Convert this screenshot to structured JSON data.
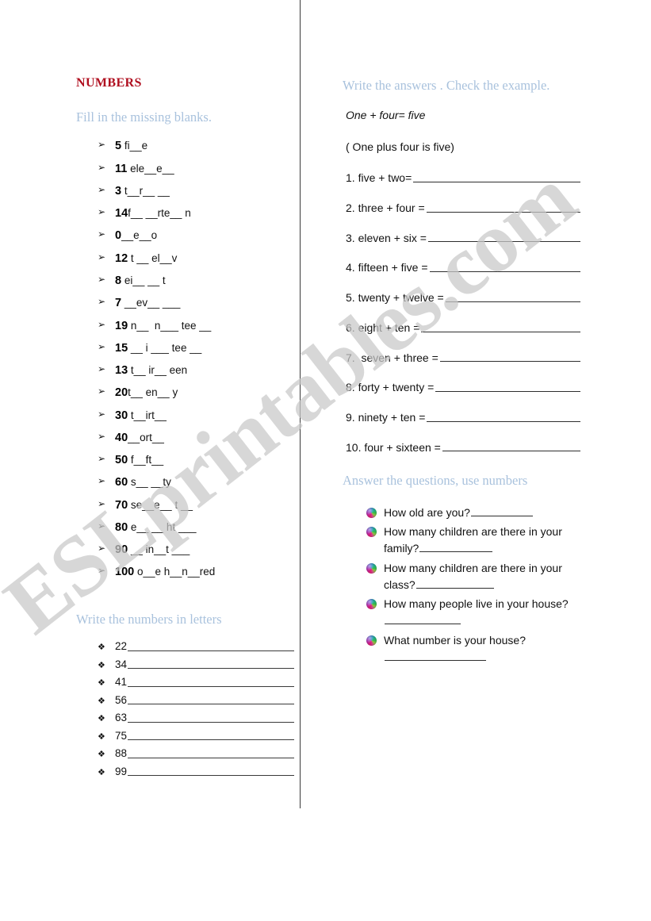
{
  "document": {
    "title_red": "NUMBERS",
    "watermark": "ESLprintables.com"
  },
  "left_column": {
    "heading_fill_blanks": "Fill in the missing blanks.",
    "fill_items": [
      {
        "number": "5",
        "text": " fi__e"
      },
      {
        "number": "11",
        "text": " ele__e__"
      },
      {
        "number": "3",
        "text": " t__r__ __"
      },
      {
        "number": "14",
        "text": "f__ __rte__ n"
      },
      {
        "number": "0",
        "text": "__e__o"
      },
      {
        "number": "12",
        "text": " t __ el__v"
      },
      {
        "number": "8",
        "text": " ei__ __ t"
      },
      {
        "number": "7",
        "text": " __ev__ ___"
      },
      {
        "number": "19",
        "text": " n__  n___ tee __"
      },
      {
        "number": "15",
        "text": " __ i ___ tee __"
      },
      {
        "number": "13",
        "text": " t__ ir__ een"
      },
      {
        "number": "20",
        "text": "t__ en__ y"
      },
      {
        "number": "30",
        "text": " t__irt__"
      },
      {
        "number": "40",
        "text": "__ort__"
      },
      {
        "number": "50",
        "text": " f__ft__"
      },
      {
        "number": "60",
        "text": " s__ __ty"
      },
      {
        "number": "70",
        "text": " se__e__ t __"
      },
      {
        "number": "80",
        "text": " e__ __ ht ___"
      },
      {
        "number": "90",
        "text": " __ in__t ___"
      },
      {
        "number": "100",
        "text": " o__e h__n__red"
      }
    ],
    "heading_write_letters": "Write the numbers in letters",
    "letter_items": [
      "22",
      "34",
      "41",
      "56",
      "63",
      "75",
      "88",
      "99"
    ]
  },
  "right_column": {
    "heading_write_answers": "Write the answers . Check the example.",
    "example_italic": "One + four= five",
    "example_plain": "( One plus four is five)",
    "math_items": [
      "1. five + two=",
      "2. three + four =",
      "3. eleven + six =",
      "4. fifteen + five =",
      "5. twenty + twelve =",
      "6. eight + ten =",
      "7.  seven + three =",
      "8. forty + twenty =",
      "9. ninety + ten =",
      "10. four + sixteen ="
    ],
    "heading_answer_questions": "Answer the questions, use numbers",
    "questions": [
      {
        "text": "How old are you?",
        "rule_width": 78,
        "inline": true
      },
      {
        "text": "How many children are there in your family?",
        "rule_width": 92,
        "inline": true
      },
      {
        "text": "How many children are there in your class?",
        "rule_width": 98,
        "inline": true
      },
      {
        "text": "How many people live in your house?",
        "rule_width": 96,
        "inline": true
      },
      {
        "text": "What number is your house?",
        "rule_width": 128,
        "inline": true
      }
    ]
  },
  "colors": {
    "title_red": "#b01020",
    "heading_blue": "#a9c2dd",
    "rule": "#2e2e2e",
    "watermark": "#c9c9c9"
  },
  "icons": {
    "arrow_bullet": "➢",
    "diamond_bullet": "❖"
  }
}
